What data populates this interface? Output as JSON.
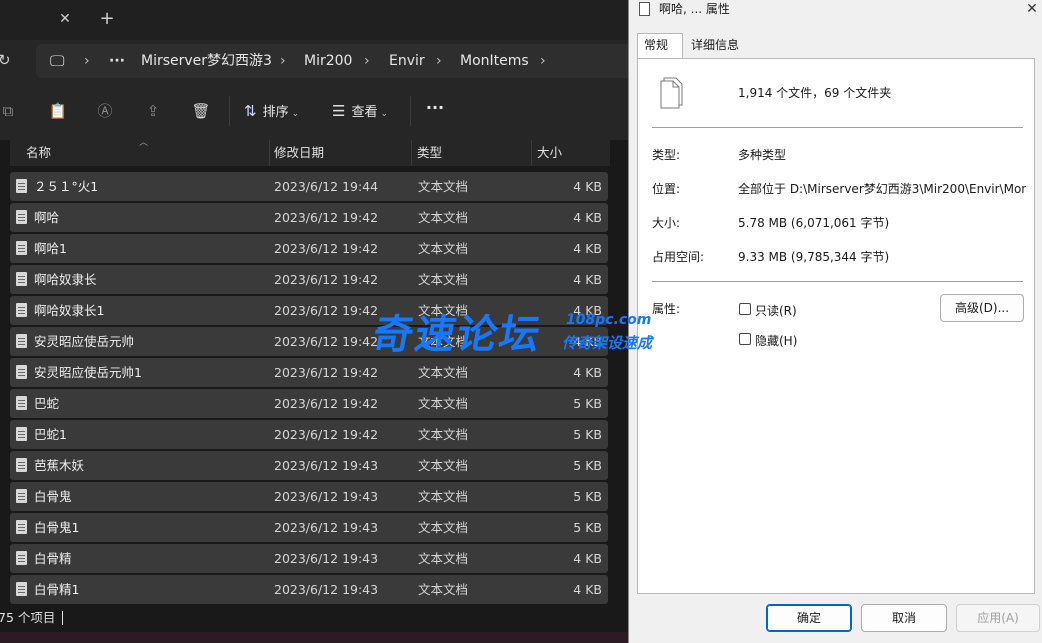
{
  "explorer": {
    "address": [
      "Mirserver梦幻西游3",
      "Mir200",
      "Envir",
      "MonItems"
    ],
    "toolbar": {
      "sort_label": "排序",
      "view_label": "查看"
    },
    "columns": {
      "name": "名称",
      "date": "修改日期",
      "type": "类型",
      "size": "大小"
    },
    "rows": [
      {
        "name": "２５１°火1",
        "date": "2023/6/12 19:44",
        "type": "文本文档",
        "size": "4 KB"
      },
      {
        "name": "啊哈",
        "date": "2023/6/12 19:42",
        "type": "文本文档",
        "size": "4 KB"
      },
      {
        "name": "啊哈1",
        "date": "2023/6/12 19:42",
        "type": "文本文档",
        "size": "4 KB"
      },
      {
        "name": "啊哈奴隶长",
        "date": "2023/6/12 19:42",
        "type": "文本文档",
        "size": "4 KB"
      },
      {
        "name": "啊哈奴隶长1",
        "date": "2023/6/12 19:42",
        "type": "文本文档",
        "size": "4 KB"
      },
      {
        "name": "安灵昭应使岳元帅",
        "date": "2023/6/12 19:42",
        "type": "文本文档",
        "size": "4 KB"
      },
      {
        "name": "安灵昭应使岳元帅1",
        "date": "2023/6/12 19:42",
        "type": "文本文档",
        "size": "4 KB"
      },
      {
        "name": "巴蛇",
        "date": "2023/6/12 19:42",
        "type": "文本文档",
        "size": "5 KB"
      },
      {
        "name": "巴蛇1",
        "date": "2023/6/12 19:42",
        "type": "文本文档",
        "size": "5 KB"
      },
      {
        "name": "芭蕉木妖",
        "date": "2023/6/12 19:43",
        "type": "文本文档",
        "size": "5 KB"
      },
      {
        "name": "白骨鬼",
        "date": "2023/6/12 19:43",
        "type": "文本文档",
        "size": "5 KB"
      },
      {
        "name": "白骨鬼1",
        "date": "2023/6/12 19:43",
        "type": "文本文档",
        "size": "5 KB"
      },
      {
        "name": "白骨精",
        "date": "2023/6/12 19:43",
        "type": "文本文档",
        "size": "4 KB"
      },
      {
        "name": "白骨精1",
        "date": "2023/6/12 19:43",
        "type": "文本文档",
        "size": "4 KB"
      }
    ],
    "status": "75 个项目"
  },
  "properties": {
    "title": "啊哈, ... 属性",
    "tabs": {
      "general": "常规",
      "details": "详细信息"
    },
    "summary": "1,914 个文件，69 个文件夹",
    "type_label": "类型:",
    "type_value": "多种类型",
    "location_label": "位置:",
    "location_value": "全部位于 D:\\Mirserver梦幻西游3\\Mir200\\Envir\\Mon",
    "size_label": "大小:",
    "size_value": "5.78 MB (6,071,061 字节)",
    "disk_label": "占用空间:",
    "disk_value": "9.33 MB (9,785,344 字节)",
    "attr_label": "属性:",
    "readonly_label": "只读(R)",
    "hidden_label": "隐藏(H)",
    "advanced_label": "高级(D)...",
    "ok_label": "确定",
    "cancel_label": "取消",
    "apply_label": "应用(A)"
  },
  "watermark": {
    "main": "奇速论坛",
    "url": "108pc.com",
    "sub": "传奇架设速成"
  },
  "colors": {
    "accent": "#0067c0",
    "watermark": "#1677ff",
    "row_bg": "#3a3a3a"
  }
}
